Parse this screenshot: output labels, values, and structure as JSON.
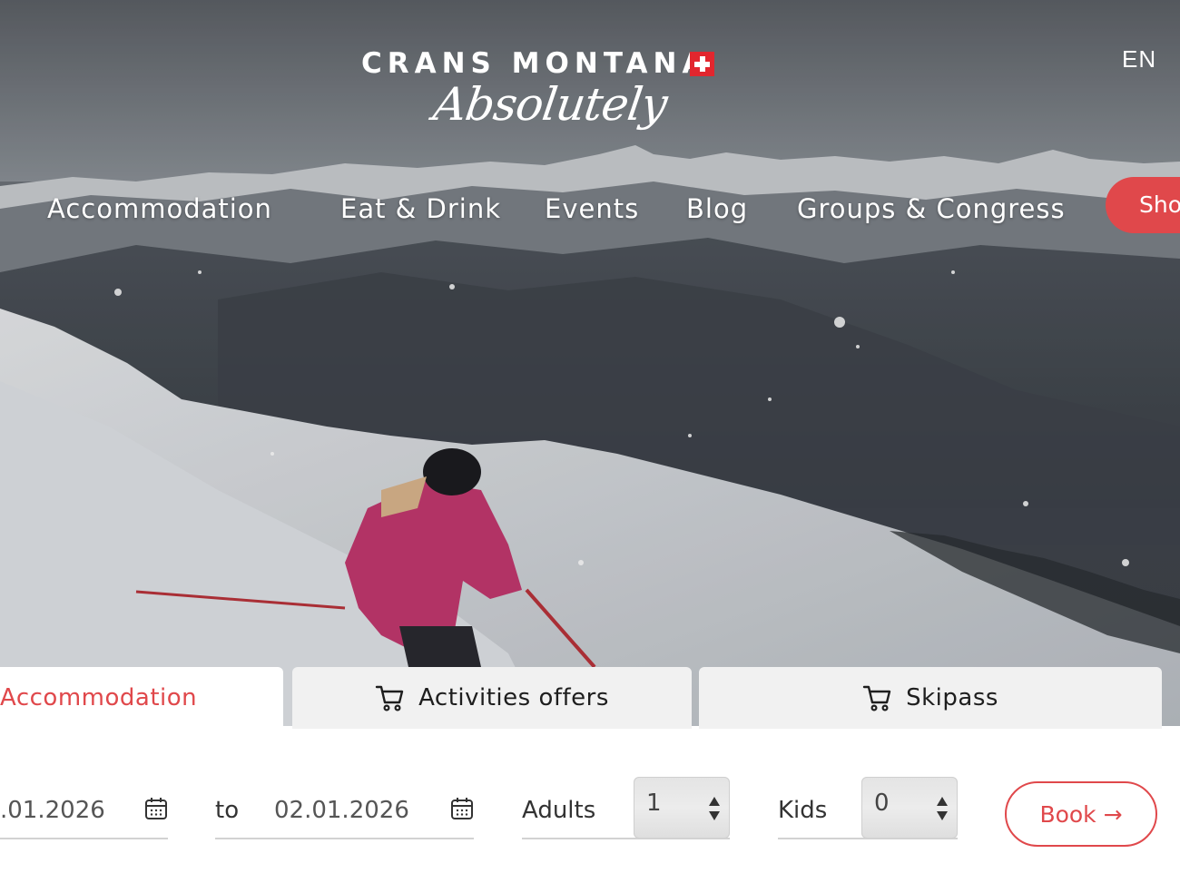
{
  "brand": {
    "name": "CRANS MONTANA",
    "tagline": "Absolutely"
  },
  "language": "EN",
  "nav": {
    "items": [
      "Accommodation",
      "Eat & Drink",
      "Events",
      "Blog",
      "Groups & Congress"
    ],
    "shop_label": "Sho"
  },
  "tabs": [
    {
      "label": "Accommodation",
      "active": true
    },
    {
      "label": "Activities offers",
      "icon": "cart-icon"
    },
    {
      "label": "Skipass",
      "icon": "cart-icon"
    }
  ],
  "booking": {
    "date_from": ".01.2026",
    "to_label": "to",
    "date_to": "02.01.2026",
    "adults_label": "Adults",
    "adults_value": "1",
    "kids_label": "Kids",
    "kids_value": "0",
    "book_label": "Book →"
  },
  "colors": {
    "accent": "#e0484b",
    "swiss_red": "#e2262e",
    "tab_inactive": "#f1f1f1"
  }
}
